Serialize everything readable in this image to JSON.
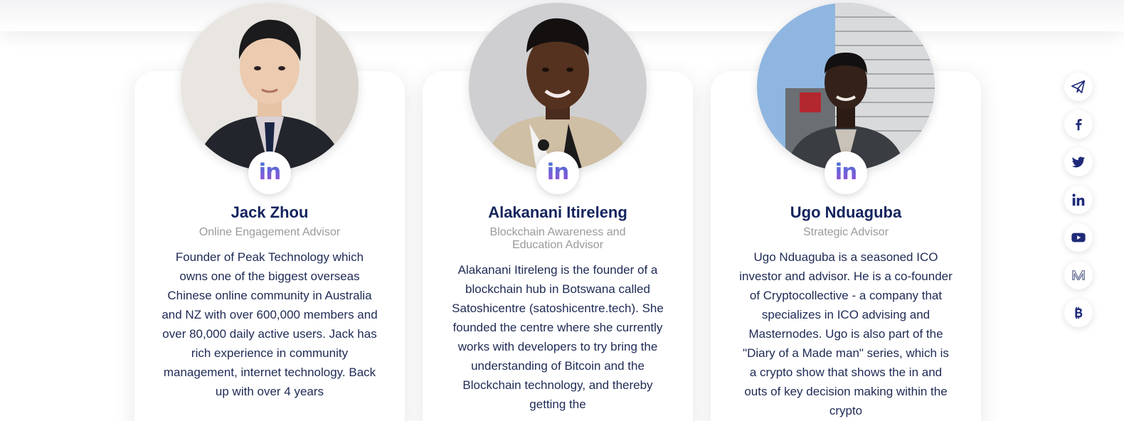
{
  "team": {
    "members": [
      {
        "name": "Jack Zhou",
        "role": "Online Engagement Advisor",
        "bio": "Founder of Peak Technology which owns one of the biggest overseas Chinese online community in Australia and NZ with over 600,000 members and over 80,000 daily active users. Jack has rich experience in community management, internet technology. Back up with over 4 years",
        "linkedin_label": "in"
      },
      {
        "name": "Alakanani Itireleng",
        "role": "Blockchain Awareness and Education Advisor",
        "bio": "Alakanani Itireleng is the founder of a blockchain hub in Botswana called Satoshicentre (satoshicentre.tech). She founded the centre where she currently works with developers to try bring the understanding of Bitcoin and the Blockchain technology, and thereby getting the",
        "linkedin_label": "in"
      },
      {
        "name": "Ugo Nduaguba",
        "role": "Strategic Advisor",
        "bio": "Ugo Nduaguba is a seasoned ICO investor and advisor. He is a co-founder of Cryptocollective - a company that specializes in ICO advising and Masternodes. Ugo is also part of the \"Diary of a Made man\" series, which is a crypto show that shows the in and outs of key decision making within the crypto",
        "linkedin_label": "in"
      }
    ]
  },
  "social_bar": {
    "icons": [
      "telegram-icon",
      "facebook-icon",
      "twitter-icon",
      "linkedin-icon",
      "youtube-icon",
      "medium-icon",
      "bitcoin-icon"
    ],
    "icon_color": "#1e2a78"
  },
  "colors": {
    "name": "#14245e",
    "role": "#9a9a9e",
    "bio": "#1e2a55",
    "linkedin_gradient_start": "#3a78d6",
    "linkedin_gradient_end": "#a34ad6"
  }
}
